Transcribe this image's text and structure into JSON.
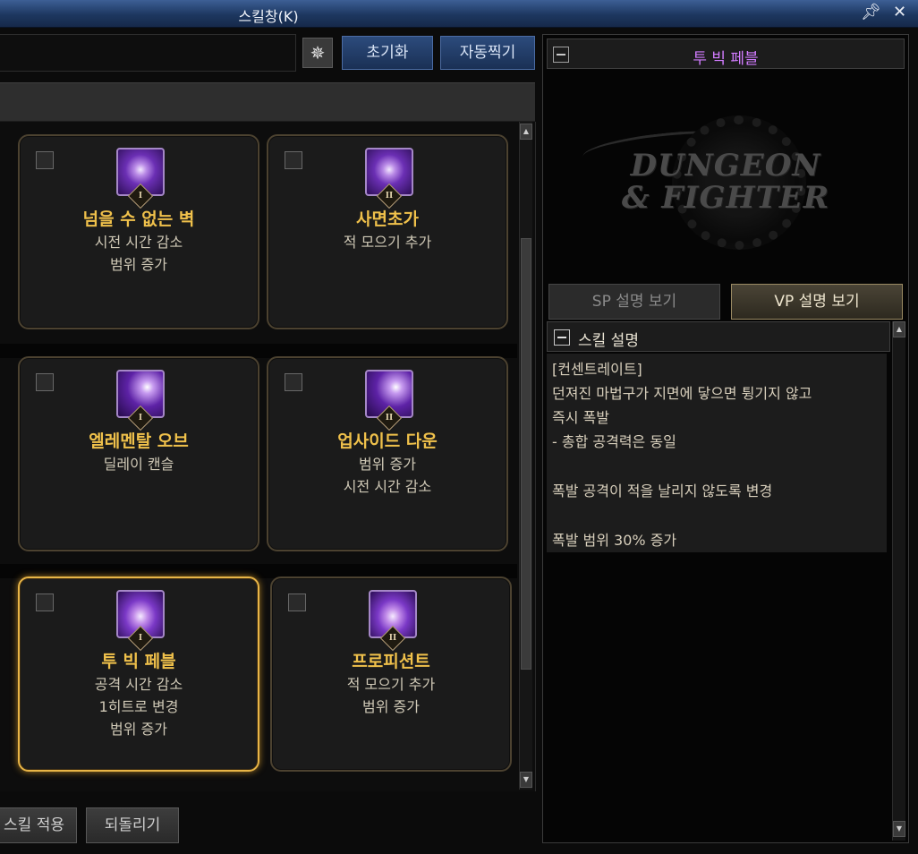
{
  "window": {
    "title": "스킬창(K)"
  },
  "toolbar": {
    "reset_label": "초기화",
    "auto_label": "자동찍기"
  },
  "cards": [
    {
      "name": "넘을 수 없는 벽",
      "desc": [
        "시전 시간 감소",
        "범위 증가"
      ],
      "rank": "I",
      "icon": "lightning-skill-icon",
      "selected": false
    },
    {
      "name": "사면초가",
      "desc": [
        "적 모으기 추가"
      ],
      "rank": "II",
      "icon": "lightning-skill-icon",
      "selected": false
    },
    {
      "name": "엘레멘탈 오브",
      "desc": [
        "딜레이 캔슬"
      ],
      "rank": "I",
      "icon": "orb-skill-icon",
      "selected": false
    },
    {
      "name": "업사이드 다운",
      "desc": [
        "범위 증가",
        "시전 시간 감소"
      ],
      "rank": "II",
      "icon": "orb-skill-icon",
      "selected": false
    },
    {
      "name": "투 빅 페블",
      "desc": [
        "공격 시간 감소",
        "1히트로 변경",
        "범위 증가"
      ],
      "rank": "I",
      "icon": "swirl-skill-icon",
      "selected": true
    },
    {
      "name": "프로피션트",
      "desc": [
        "적 모으기 추가",
        "범위 증가"
      ],
      "rank": "II",
      "icon": "swirl-skill-icon",
      "selected": false
    }
  ],
  "footer": {
    "apply_label": "스킬 적용",
    "revert_label": "되돌리기"
  },
  "detail": {
    "title": "투 빅 페블",
    "logo_text": [
      "DUNGEON",
      "& FIGHTER"
    ],
    "sp_button": "SP 설명 보기",
    "vp_button": "VP 설명 보기",
    "section_title": "스킬 설명",
    "lines": [
      "[컨센트레이트]",
      "던져진 마법구가 지면에 닿으면 튕기지 않고",
      "즉시 폭발",
      " - 총합 공격력은 동일",
      "",
      "폭발 공격이 적을 날리지 않도록 변경",
      "",
      "폭발 범위 30% 증가"
    ]
  },
  "colors": {
    "title_bar": "#1d3760",
    "skill_name": "#f0c14b",
    "selected_border": "#e8b547",
    "detail_title": "#d27cff"
  }
}
